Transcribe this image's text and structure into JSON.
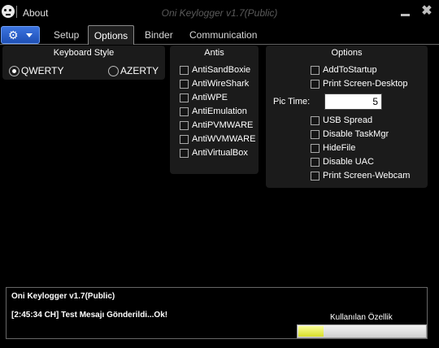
{
  "titlebar": {
    "about_label": "About",
    "window_title": "Oni Keylogger v1.7(Public)",
    "close_glyph": "✖",
    "icons": {
      "app": "skull-icon",
      "minimize": "minimize-icon",
      "close": "close-icon"
    }
  },
  "app_menu": {
    "icon": "gear-icon",
    "glyph": "⚙"
  },
  "tabs": [
    {
      "label": "Setup",
      "active": false
    },
    {
      "label": "Options",
      "active": true
    },
    {
      "label": "Binder",
      "active": false
    },
    {
      "label": "Communication",
      "active": false
    }
  ],
  "keyboard_style": {
    "title": "Keyboard Style",
    "options": [
      {
        "label": "QWERTY",
        "selected": true
      },
      {
        "label": "AZERTY",
        "selected": false
      }
    ]
  },
  "antis": {
    "title": "Antis",
    "items": [
      {
        "label": "AntiSandBoxie",
        "checked": false
      },
      {
        "label": "AntiWireShark",
        "checked": false
      },
      {
        "label": "AntiWPE",
        "checked": false
      },
      {
        "label": "AntiEmulation",
        "checked": false
      },
      {
        "label": "AntiPVMWARE",
        "checked": false
      },
      {
        "label": "AntiWVMWARE",
        "checked": false
      },
      {
        "label": "AntiVirtualBox",
        "checked": false
      }
    ]
  },
  "options": {
    "title": "Options",
    "items_top": [
      {
        "label": "AddToStartup",
        "checked": false
      },
      {
        "label": "Print Screen-Desktop",
        "checked": false
      }
    ],
    "pic_time_label": "Pic Time:",
    "pic_time_value": "5",
    "items_bottom": [
      {
        "label": "USB Spread",
        "checked": false
      },
      {
        "label": "Disable TaskMgr",
        "checked": false
      },
      {
        "label": "HideFile",
        "checked": false
      },
      {
        "label": "Disable UAC",
        "checked": false
      },
      {
        "label": "Print Screen-Webcam",
        "checked": false
      }
    ]
  },
  "status": {
    "title": "Oni Keylogger v1.7(Public)",
    "message": "[2:45:34 CH] Test Mesajı Gönderildi...Ok!",
    "feature_label": "Kullanılan Özellik",
    "progress_fraction": 0.2
  },
  "colors": {
    "background": "#000000",
    "panel": "#1b1b1b",
    "menu_button": "#2a5fd0",
    "progress_fill": "#e6ec4a"
  }
}
